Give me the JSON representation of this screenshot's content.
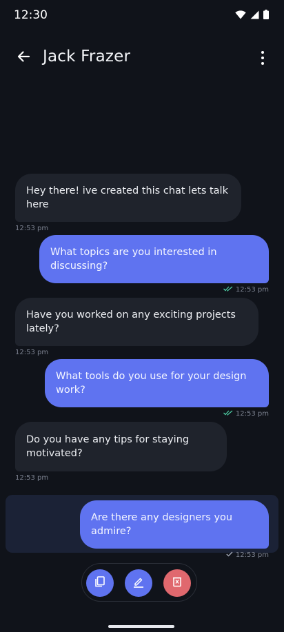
{
  "status_bar": {
    "time": "12:30",
    "icons": [
      "wifi-icon",
      "cellular-icon",
      "battery-icon"
    ]
  },
  "app_bar": {
    "back_icon": "arrow-left-icon",
    "title": "Jack Frazer",
    "menu_icon": "more-vertical-icon"
  },
  "messages": [
    {
      "direction": "incoming",
      "text": "Hey there! ive created this chat lets talk here",
      "time": "12:53 pm"
    },
    {
      "direction": "outgoing",
      "text": "What topics are you interested in discussing?",
      "time": "12:53 pm",
      "status": "read"
    },
    {
      "direction": "incoming",
      "text": "Have you worked on any exciting projects lately?",
      "time": "12:53 pm"
    },
    {
      "direction": "outgoing",
      "text": "What tools do you use for your design work?",
      "time": "12:53 pm",
      "status": "read"
    },
    {
      "direction": "incoming",
      "text": "Do you have any tips for staying motivated?",
      "time": "12:53 pm"
    },
    {
      "direction": "outgoing",
      "text": "Are there any designers you admire?",
      "time": "12:53 pm",
      "status": "sent",
      "selected": true
    }
  ],
  "action_bar": {
    "actions": [
      {
        "name": "copy",
        "icon": "copy-icon",
        "color": "#5f73f0"
      },
      {
        "name": "edit",
        "icon": "edit-icon",
        "color": "#5f73f0"
      },
      {
        "name": "delete",
        "icon": "delete-icon",
        "color": "#e0686e"
      }
    ]
  },
  "colors": {
    "background": "#10131a",
    "incoming_bubble": "#1f232c",
    "outgoing_bubble": "#5f73f0",
    "selected_highlight": "#1b2236",
    "read_check": "#4cc9a0",
    "sent_check": "#a9afbd"
  }
}
